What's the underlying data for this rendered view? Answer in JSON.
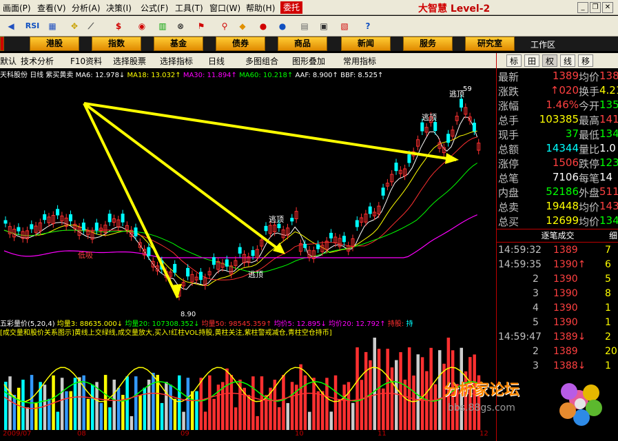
{
  "menu": [
    "画面(P)",
    "查看(V)",
    "分析(A)",
    "决策(I)",
    "公式(F)",
    "工具(T)",
    "窗口(W)",
    "帮助(H)"
  ],
  "menu_hot": "委托",
  "brand": {
    "name": "大智慧",
    "level": "Level-2"
  },
  "toolbar_icons": [
    "back-icon",
    "rsi-icon",
    "grid-icon",
    "move-icon",
    "ruler-icon",
    "dollar-icon",
    "eye-icon",
    "bars-icon",
    "binoculars-icon",
    "flag-icon",
    "pin-icon",
    "diamond-icon",
    "disc-icon",
    "ball-icon",
    "book-icon",
    "window-icon",
    "panel-icon",
    "help-icon"
  ],
  "toolbar_rsi": "RSI",
  "toolbar_dollar": "$",
  "tabs": [
    "港股",
    "指数",
    "基金",
    "债券",
    "商品",
    "新闻",
    "服务",
    "研究室"
  ],
  "workarea": "工作区",
  "subtoolbar": [
    "默认",
    "技术分析",
    "F10资料",
    "选择股票",
    "选择指标",
    "日线",
    "多图组合",
    "图形叠加",
    "常用指标"
  ],
  "infoline": {
    "stock": "天科股份",
    "period": "日线",
    "formula": "紫买黄卖",
    "ma6": "MA6: 12.978↓",
    "ma18": "MA18: 13.032↑",
    "ma30": "MA30: 11.894↑",
    "ma60": "MA60: 10.218↑",
    "aaf": "AAF: 8.900↑",
    "bbf": "BBF: 8.525↑"
  },
  "chart_annotations": {
    "dixi": "低吸",
    "taoding1": "逃顶",
    "taoding2": "逃顶",
    "taoding3": "逃顶",
    "taoding4": "逃顶",
    "low_price": "8.90",
    "high_price": "59"
  },
  "volinfo": {
    "title": "五彩量价(5,20,4)",
    "v3": "均量3: 88635.000↓",
    "v20": "均量20: 107308.352↓",
    "v50": "均量50: 98545.359↑",
    "p5": "均价5: 12.895↓",
    "p20": "均价20: 12.792↑",
    "hold": "持股:",
    "hold2": "持"
  },
  "voldesc": "[成交量和股价关系图示]黄线上交绿线,成交量放大,买入!红柱VOL持股,黄柱关注,紫柱警戒减仓,青柱空仓持币]",
  "dates": [
    "2009/07",
    "08",
    "09",
    "10",
    "11",
    "12"
  ],
  "right_tabs": [
    "标",
    "田",
    "权",
    "线",
    "移"
  ],
  "quotes": [
    {
      "l": "最新",
      "v": "1389",
      "vc": "#ff4040",
      "l2": "均价",
      "v2": "138",
      "v2c": "#ff4040"
    },
    {
      "l": "涨跌",
      "v": "↑020",
      "vc": "#ff4040",
      "l2": "换手",
      "v2": "4.21",
      "v2c": "#ffff00"
    },
    {
      "l": "涨幅",
      "v": "1.46%",
      "vc": "#ff4040",
      "l2": "今开",
      "v2": "135",
      "v2c": "#00ff00"
    },
    {
      "l": "总手",
      "v": "103385",
      "vc": "#ffff00",
      "l2": "最高",
      "v2": "141",
      "v2c": "#ff4040"
    },
    {
      "l": "现手",
      "v": "37",
      "vc": "#00ff00",
      "l2": "最低",
      "v2": "134",
      "v2c": "#00ff00"
    },
    {
      "l": "总额",
      "v": "14344",
      "vc": "#00ffff",
      "l2": "量比",
      "v2": "1.0",
      "v2c": "#ffffff"
    },
    {
      "l": "涨停",
      "v": "1506",
      "vc": "#ff4040",
      "l2": "跌停",
      "v2": "123",
      "v2c": "#00ff00"
    },
    {
      "l": "总笔",
      "v": "7106",
      "vc": "#ffffff",
      "l2": "每笔",
      "v2": "14",
      "v2c": "#ffffff"
    },
    {
      "l": "内盘",
      "v": "52186",
      "vc": "#00ff00",
      "l2": "外盘",
      "v2": "5119",
      "v2c": "#ff4040"
    },
    {
      "l": "总卖",
      "v": "19448",
      "vc": "#ffff00",
      "l2": "均价",
      "v2": "143",
      "v2c": "#ff4040"
    },
    {
      "l": "总买",
      "v": "12699",
      "vc": "#ffff00",
      "l2": "均价",
      "v2": "134",
      "v2c": "#00ff00"
    }
  ],
  "ticks_header": "逐笔成交",
  "ticks_header_right": "细",
  "ticks": [
    {
      "t": "14:59:32",
      "p": "1389",
      "v": "7",
      "vc": "#ffff00"
    },
    {
      "t": "14:59:35",
      "p": "1390↑",
      "v": "6",
      "vc": "#ffff00"
    },
    {
      "t": "2",
      "p": "1390",
      "v": "5",
      "vc": "#ffff00"
    },
    {
      "t": "3",
      "p": "1390",
      "v": "8",
      "vc": "#ffff00"
    },
    {
      "t": "4",
      "p": "1390",
      "v": "1",
      "vc": "#ffff00"
    },
    {
      "t": "5",
      "p": "1390",
      "v": "1",
      "vc": "#ffff00"
    },
    {
      "t": "14:59:47",
      "p": "1389↓",
      "v": "2",
      "vc": "#ffff00"
    },
    {
      "t": "2",
      "p": "1389",
      "v": "20",
      "vc": "#ffff00"
    },
    {
      "t": "3",
      "p": "1388↓",
      "v": "1",
      "vc": "#ffff00"
    }
  ],
  "watermark": {
    "title": "分析家论坛",
    "url": "bbs.88gs.com"
  },
  "colors": {
    "up": "#ff3030",
    "down": "#00ffff",
    "ma6": "#ffffff",
    "ma18": "#ffff00",
    "ma30": "#ff00ff",
    "ma60": "#00ff00",
    "accent": "#ffcc00"
  }
}
